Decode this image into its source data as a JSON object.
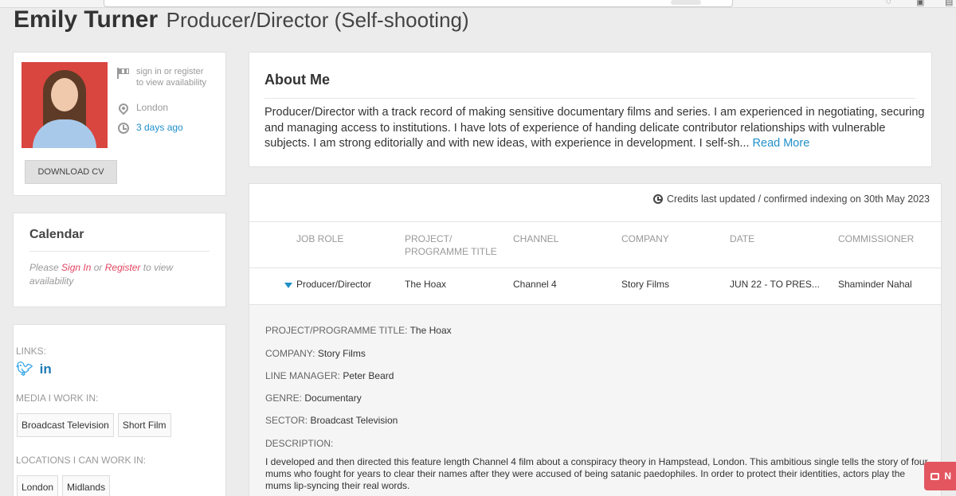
{
  "header": {
    "name": "Emily Turner",
    "title": "Producer/Director (Self-shooting)"
  },
  "profile": {
    "availability_line1": "sign in or register",
    "availability_line2": "to view availability",
    "location": "London",
    "last_active": "3 days ago",
    "download_cv_label": "DOWNLOAD CV"
  },
  "calendar": {
    "title": "Calendar",
    "text_please": "Please ",
    "sign_in": "Sign In",
    "text_or": " or ",
    "register": "Register",
    "text_rest": " to view availability"
  },
  "links": {
    "links_label": "LINKS:",
    "media_label": "MEDIA I WORK IN:",
    "media": [
      "Broadcast Television",
      "Short Film"
    ],
    "locations_label": "LOCATIONS I CAN WORK IN:",
    "locations": [
      "London",
      "Midlands"
    ]
  },
  "about": {
    "title": "About Me",
    "text": "Producer/Director with a track record of making sensitive documentary films and series. I am experienced in negotiating, securing and managing access to institutions. I have lots of experience of handing delicate contributor relationships with vulnerable subjects. I am strong editorially and with new ideas, with experience in development. I self-sh...",
    "read_more": "Read More"
  },
  "credits": {
    "updated_text": "Credits last updated / confirmed indexing on 30th May 2023",
    "columns": [
      "JOB ROLE",
      "PROJECT/ PROGRAMME TITLE",
      "CHANNEL",
      "COMPANY",
      "DATE",
      "COMMISSIONER"
    ],
    "row": {
      "job_role": "Producer/Director",
      "project": "The Hoax",
      "channel": "Channel 4",
      "company": "Story Films",
      "date": "JUN 22 - TO PRES...",
      "commissioner": "Shaminder Nahal"
    },
    "detail": {
      "project_label": "PROJECT/PROGRAMME TITLE:",
      "project_value": "The Hoax",
      "company_label": "COMPANY:",
      "company_value": "Story Films",
      "line_manager_label": "LINE MANAGER:",
      "line_manager_value": "Peter Beard",
      "genre_label": "GENRE:",
      "genre_value": "Documentary",
      "sector_label": "SECTOR:",
      "sector_value": "Broadcast Television",
      "description_label": "DESCRIPTION:",
      "description_text": "I developed and then directed this feature length Channel 4 film about a conspiracy theory in Hampstead, London. This ambitious single tells the story of four mums who fought for years to clear their names after they were accused of being satanic paedophiles. In order to protect their identities, actors play the mums lip-syncing their real words."
    }
  },
  "chat": {
    "label": "N"
  }
}
